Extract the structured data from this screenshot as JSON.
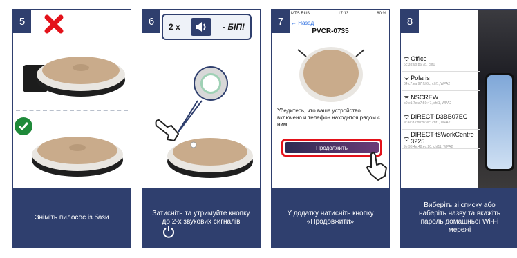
{
  "steps": [
    {
      "number": "5",
      "caption": "Зніміть пилосос із бази"
    },
    {
      "number": "6",
      "caption": "Затисніть та утримуйте кнопку до 2-х звукових сигналів",
      "callout": {
        "count": "2 x",
        "sound": "- БІП!"
      }
    },
    {
      "number": "7",
      "caption": "У додатку натисніть кнопку «Продовжити»",
      "phone": {
        "carrier": "MTS RUS",
        "time": "17:13",
        "battery": "80 %",
        "back": "← Назад",
        "title": "PVCR-0735",
        "message": "Убедитесь, что ваше устройство включено и телефон находится рядом с ним",
        "button": "Продолжить"
      }
    },
    {
      "number": "8",
      "caption": "Виберіть зі списку або наберіть назву та вкажіть пароль домашньої Wi-Fi мережі",
      "networks": [
        {
          "name": "Office",
          "details": "6c:3b:6b:b6:7b, chf1"
        },
        {
          "name": "Polaris",
          "details": "84:c7:ea:97:fd:6c, chf1, WPA2"
        },
        {
          "name": "NSCREW",
          "details": "b0:e1:7e:a7:50:47, chf1, WPA2"
        },
        {
          "name": "DIRECT-D3BB07EC",
          "details": "fe:ae:d3:bb:87:ec, chf1, WPA2"
        },
        {
          "name": "DIRECT-t8WorkCentre 3225",
          "details": "9e:93:4e:48:ec:20, chf11, WPA2"
        }
      ]
    }
  ],
  "colors": {
    "accent": "#2f3f6e",
    "error": "#e3121a",
    "success": "#1f8a3a"
  }
}
